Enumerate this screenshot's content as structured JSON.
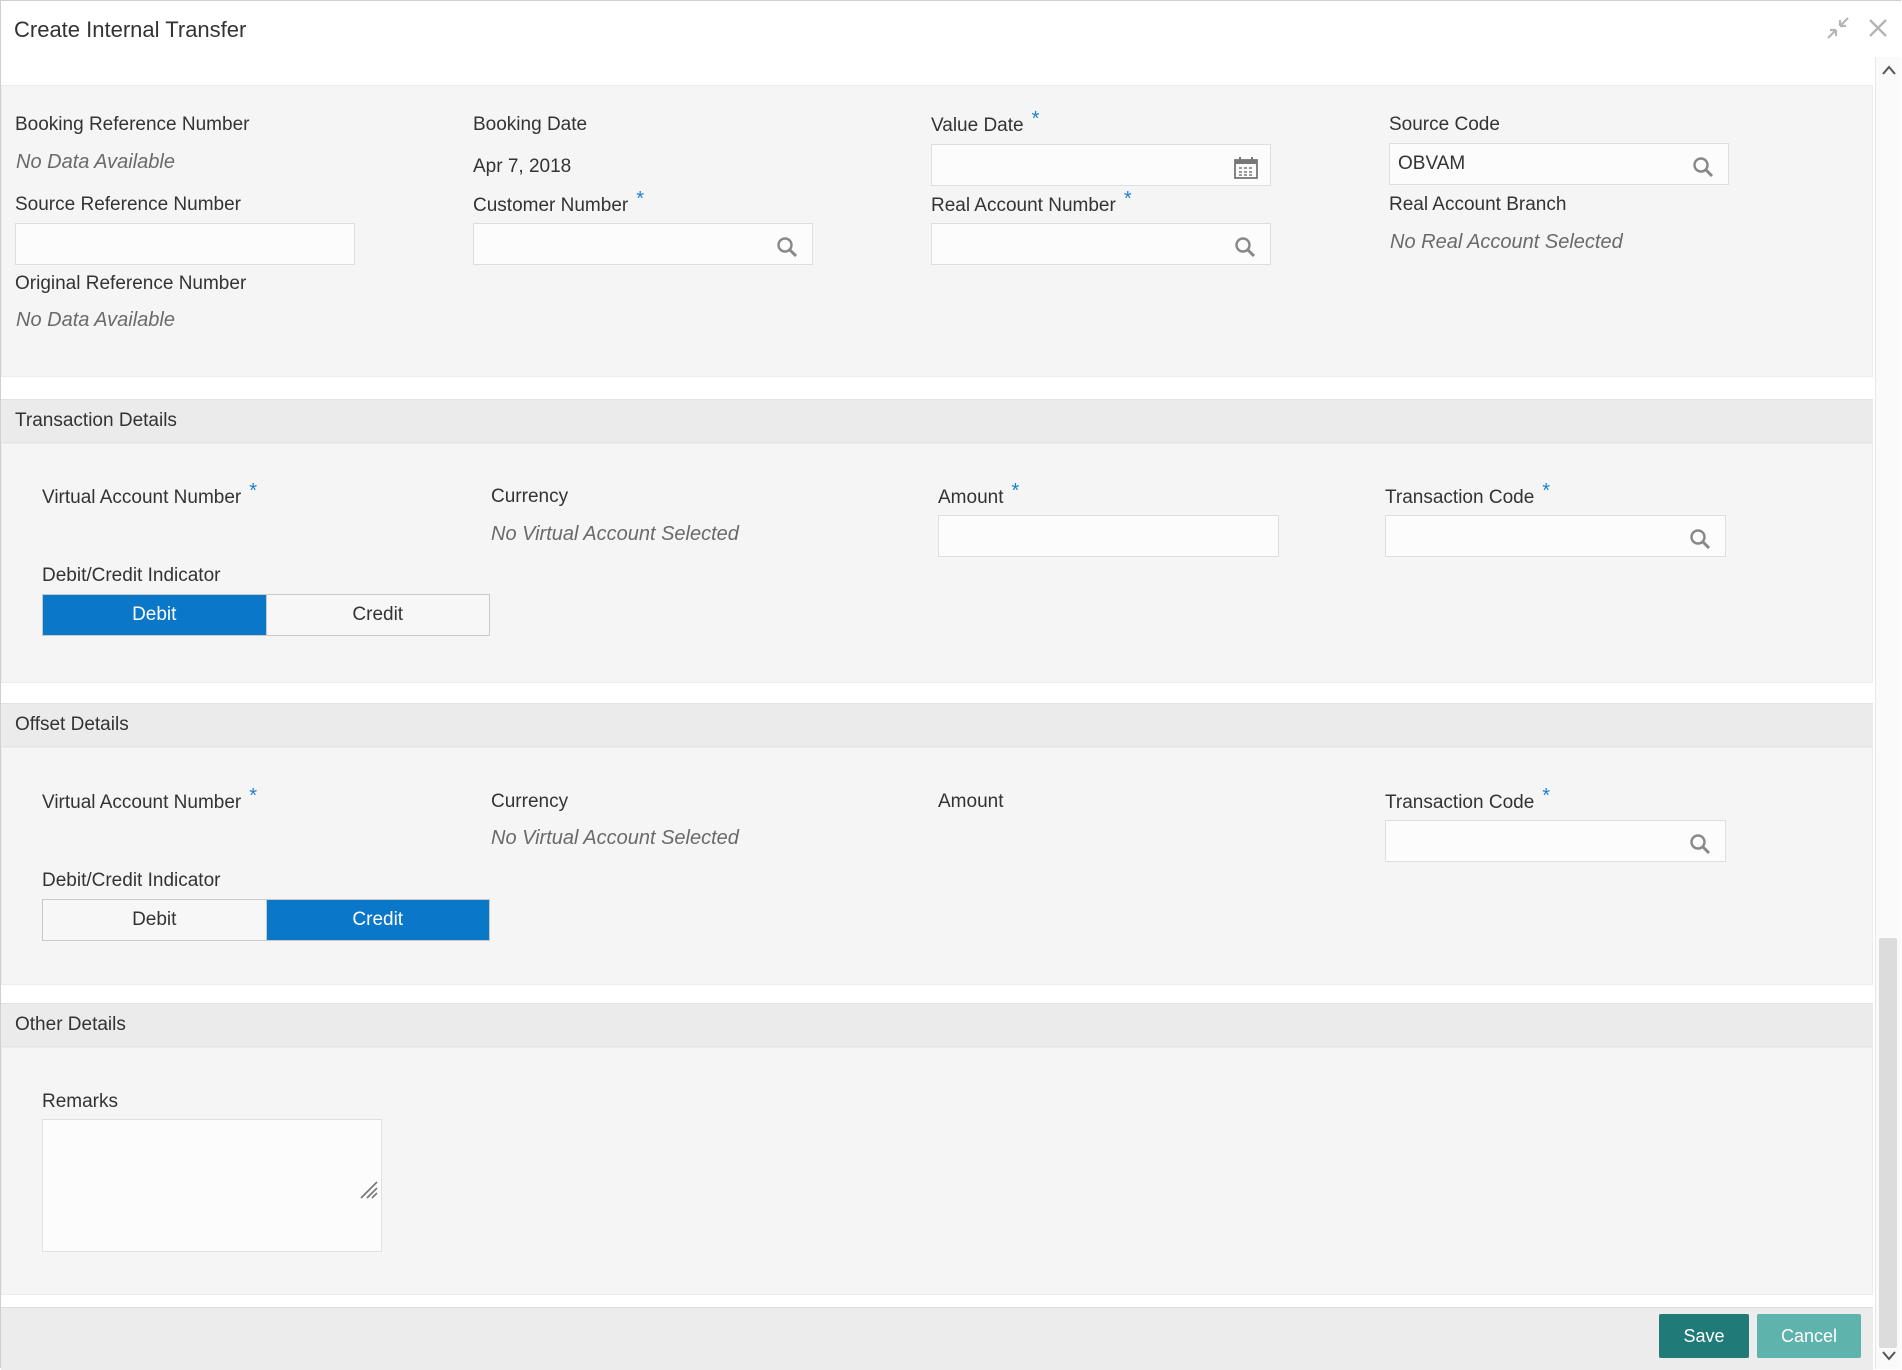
{
  "window": {
    "title": "Create Internal Transfer"
  },
  "booking": {
    "booking_ref_label": "Booking Reference Number",
    "booking_ref_value": "No Data Available",
    "booking_date_label": "Booking Date",
    "booking_date_value": "Apr 7, 2018",
    "value_date_label": "Value Date",
    "source_code_label": "Source Code",
    "source_code_value": "OBVAM",
    "source_ref_label": "Source Reference Number",
    "customer_number_label": "Customer Number",
    "real_account_label": "Real Account Number",
    "real_branch_label": "Real Account Branch",
    "real_branch_value": "No Real Account Selected",
    "original_ref_label": "Original Reference Number",
    "original_ref_value": "No Data Available"
  },
  "transaction": {
    "header": "Transaction Details",
    "virtual_account_label": "Virtual Account Number",
    "currency_label": "Currency",
    "currency_value": "No Virtual Account Selected",
    "amount_label": "Amount",
    "transaction_code_label": "Transaction Code",
    "dc_label": "Debit/Credit Indicator",
    "debit": "Debit",
    "credit": "Credit",
    "selected": "Debit"
  },
  "offset": {
    "header": "Offset Details",
    "virtual_account_label": "Virtual Account Number",
    "currency_label": "Currency",
    "currency_value": "No Virtual Account Selected",
    "amount_label": "Amount",
    "transaction_code_label": "Transaction Code",
    "dc_label": "Debit/Credit Indicator",
    "debit": "Debit",
    "credit": "Credit",
    "selected": "Credit"
  },
  "other": {
    "header": "Other Details",
    "remarks_label": "Remarks"
  },
  "footer": {
    "save": "Save",
    "cancel": "Cancel"
  },
  "required_marker": "*",
  "colors": {
    "accent": "#0b77c8",
    "save": "#1f7a78",
    "cancel": "#5fb3ad",
    "required": "#1d7fd1"
  }
}
